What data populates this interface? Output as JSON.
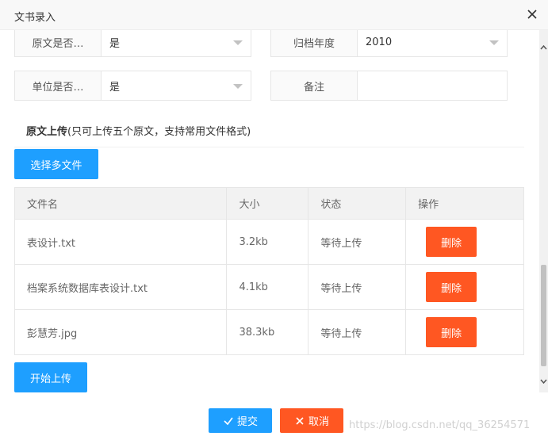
{
  "dialog": {
    "title": "文书录入"
  },
  "form": {
    "row1": {
      "left_label": "原文是否…",
      "left_value": "是",
      "right_label": "归档年度",
      "right_value": "2010"
    },
    "row2": {
      "left_label": "单位是否…",
      "left_value": "是",
      "right_label": "备注",
      "right_value": ""
    }
  },
  "upload": {
    "title_bold": "原文上传",
    "title_note": "(只可上传五个原文，支持常用文件格式)",
    "select_button": "选择多文件",
    "start_button": "开始上传",
    "columns": [
      "文件名",
      "大小",
      "状态",
      "操作"
    ],
    "rows": [
      {
        "name": "表设计.txt",
        "size": "3.2kb",
        "status": "等待上传",
        "action": "删除"
      },
      {
        "name": "档案系统数据库表设计.txt",
        "size": "4.1kb",
        "status": "等待上传",
        "action": "删除"
      },
      {
        "name": "彭慧芳.jpg",
        "size": "38.3kb",
        "status": "等待上传",
        "action": "删除"
      }
    ]
  },
  "footer": {
    "submit": "提交",
    "cancel": "取消",
    "watermark": "https://blog.csdn.net/qq_36254571"
  },
  "colors": {
    "primary": "#1e9fff",
    "danger": "#ff5722"
  }
}
